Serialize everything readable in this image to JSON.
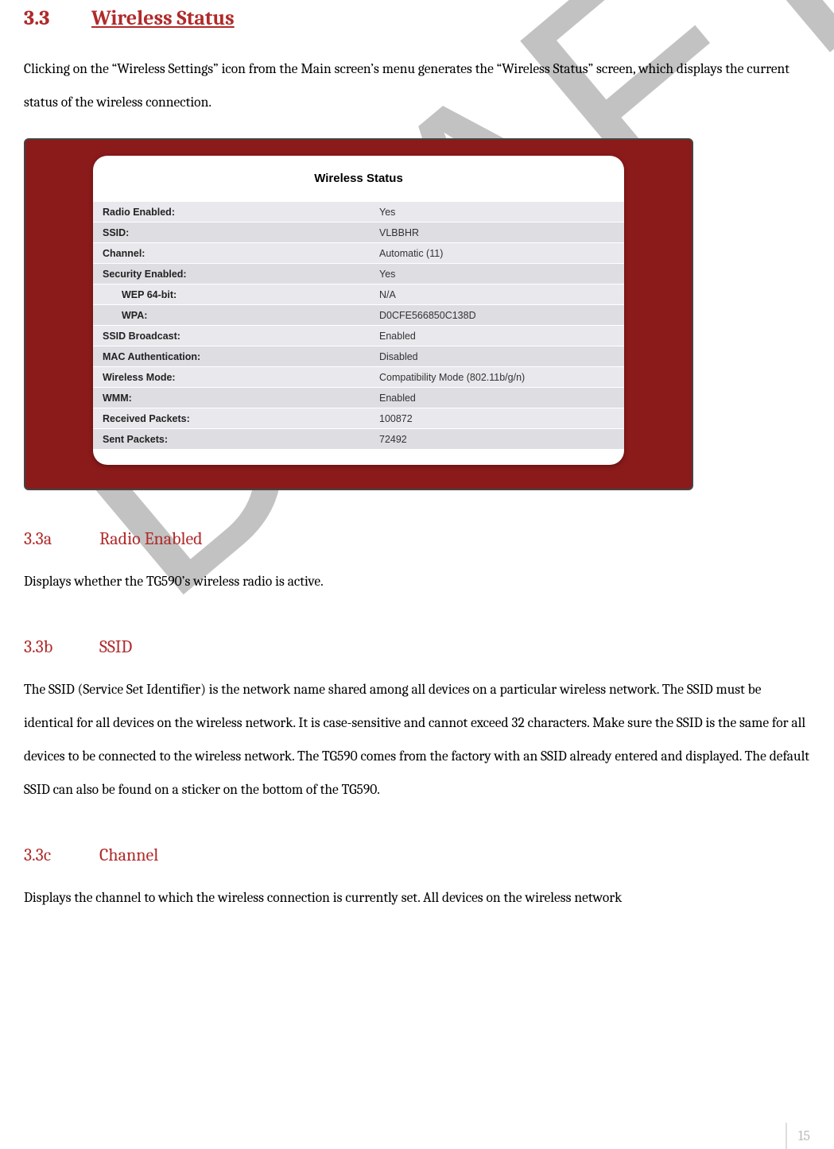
{
  "watermark": "DRAFT",
  "section": {
    "num": "3.3",
    "title": "Wireless Status"
  },
  "intro": "Clicking on the “Wireless Settings” icon from the Main screen’s menu generates the “Wireless Status” screen, which displays the current status of the wireless connection.",
  "panel": {
    "title": "Wireless Status",
    "rows": [
      {
        "label": "Radio Enabled:",
        "value": "Yes",
        "indent": false
      },
      {
        "label": "SSID:",
        "value": "VLBBHR",
        "indent": false
      },
      {
        "label": "Channel:",
        "value": "Automatic (11)",
        "indent": false
      },
      {
        "label": "Security Enabled:",
        "value": "Yes",
        "indent": false
      },
      {
        "label": "WEP 64-bit:",
        "value": "N/A",
        "indent": true
      },
      {
        "label": "WPA:",
        "value": "D0CFE566850C138D",
        "indent": true
      },
      {
        "label": "SSID Broadcast:",
        "value": "Enabled",
        "indent": false
      },
      {
        "label": "MAC Authentication:",
        "value": "Disabled",
        "indent": false
      },
      {
        "label": "Wireless Mode:",
        "value": "Compatibility Mode (802.11b/g/n)",
        "indent": false
      },
      {
        "label": "WMM:",
        "value": "Enabled",
        "indent": false
      },
      {
        "label": "Received Packets:",
        "value": "100872",
        "indent": false
      },
      {
        "label": "Sent Packets:",
        "value": "72492",
        "indent": false
      }
    ]
  },
  "subsections": {
    "a": {
      "num": "3.3a",
      "title": "Radio Enabled",
      "body": "Displays whether the TG590’s wireless radio is active."
    },
    "b": {
      "num": "3.3b",
      "title": "SSID",
      "body": "The SSID (Service Set Identifier) is the network name shared among all devices on a particular wireless network. The SSID must be identical for all devices on the wireless network. It is case-sensitive and cannot exceed 32 characters. Make sure the SSID is the same for all devices to be connected to the wireless network. The TG590 comes from the factory with an SSID already entered and displayed. The default SSID can also be found on a sticker on the bottom of the TG590."
    },
    "c": {
      "num": "3.3c",
      "title": "Channel",
      "body": "Displays the channel to which the wireless connection is currently set. All devices on the wireless network"
    }
  },
  "pageNumber": "15"
}
